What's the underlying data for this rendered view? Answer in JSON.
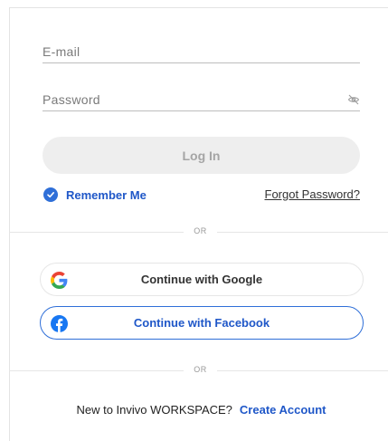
{
  "login_form": {
    "email": {
      "placeholder": "E-mail",
      "value": ""
    },
    "password": {
      "placeholder": "Password",
      "value": "",
      "toggle_icon": "eye-off-icon"
    },
    "login_label": "Log In",
    "remember_me": {
      "label": "Remember Me",
      "checked": true
    },
    "forgot_password": "Forgot Password?"
  },
  "dividers": {
    "or_1": "OR",
    "or_2": "OR"
  },
  "social": {
    "google_label": "Continue with Google",
    "google_icon": "google-icon",
    "facebook_label": "Continue with Facebook",
    "facebook_icon": "facebook-icon"
  },
  "footer": {
    "prompt": "New to Invivo WORKSPACE?",
    "create_account": "Create Account"
  },
  "colors": {
    "accent": "#1f57c8",
    "checkbox": "#2f6fd8",
    "disabled_button_bg": "#eeeeee",
    "disabled_button_text": "#a5a5a5",
    "facebook": "#1877f2"
  }
}
